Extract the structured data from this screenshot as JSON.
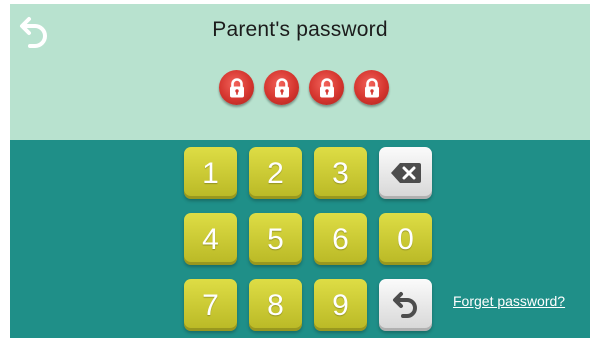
{
  "header": {
    "back_icon": "back-arrow-icon",
    "title": "Parent's password"
  },
  "pin": {
    "length": 4,
    "dot_icon": "padlock-icon",
    "dot_color": "#d5362f"
  },
  "keypad": {
    "keys": [
      "1",
      "2",
      "3",
      "4",
      "5",
      "6",
      "0",
      "7",
      "8",
      "9"
    ],
    "backspace_icon": "backspace-icon",
    "return_icon": "return-arrow-icon",
    "key_color": "#cfce36"
  },
  "forgot_password": "Forget password?",
  "colors": {
    "top_panel": "#b8e2cf",
    "bottom_panel": "#1f8f88"
  }
}
